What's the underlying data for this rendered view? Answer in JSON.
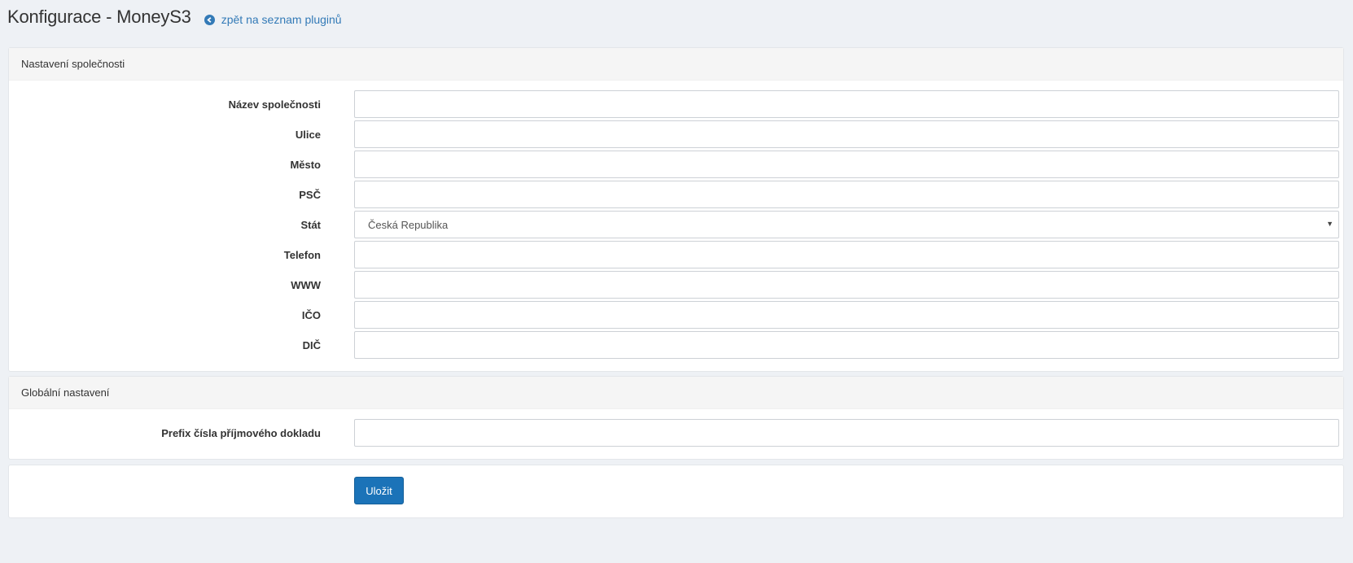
{
  "header": {
    "title": "Konfigurace - MoneyS3",
    "back_link": "zpět na seznam pluginů",
    "back_icon": "arrow-circle-left-icon"
  },
  "company_panel": {
    "heading": "Nastavení společnosti",
    "fields": [
      {
        "label": "Název společnosti",
        "value": "",
        "placeholder": ""
      },
      {
        "label": "Ulice",
        "value": "",
        "placeholder": ""
      },
      {
        "label": "Město",
        "value": "",
        "placeholder": ""
      },
      {
        "label": "PSČ",
        "value": "",
        "placeholder": ""
      },
      {
        "label": "Stát",
        "value": "Česká Republika"
      },
      {
        "label": "Telefon",
        "value": "",
        "placeholder": ""
      },
      {
        "label": "WWW",
        "value": "",
        "placeholder": ""
      },
      {
        "label": "IČO",
        "value": "",
        "placeholder": ""
      },
      {
        "label": "DIČ",
        "value": "",
        "placeholder": ""
      }
    ]
  },
  "global_panel": {
    "heading": "Globální nastavení",
    "fields": [
      {
        "label": "Prefix čísla příjmového dokladu",
        "value": "",
        "placeholder": ""
      }
    ]
  },
  "actions": {
    "save_label": "Uložit"
  },
  "colors": {
    "primary": "#1b73b8",
    "link": "#337ab7",
    "background": "#eef1f5"
  }
}
